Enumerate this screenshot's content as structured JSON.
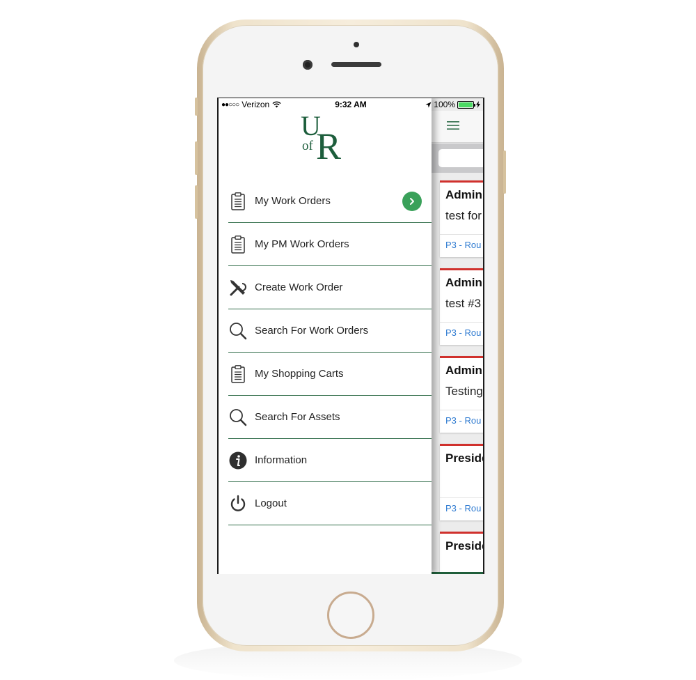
{
  "status_bar": {
    "carrier": "Verizon",
    "signal_dots": "●●○○○",
    "time": "9:32 AM",
    "battery": "100%"
  },
  "logo": {
    "u": "U",
    "of": "of",
    "r": "R"
  },
  "menu": {
    "items": [
      {
        "label": "My Work Orders",
        "icon": "clipboard-icon"
      },
      {
        "label": "My PM Work Orders",
        "icon": "clipboard-icon"
      },
      {
        "label": "Create Work Order",
        "icon": "tools-icon"
      },
      {
        "label": "Search For Work Orders",
        "icon": "search-icon"
      },
      {
        "label": "My Shopping Carts",
        "icon": "clipboard-icon"
      },
      {
        "label": "Search For Assets",
        "icon": "search-icon"
      },
      {
        "label": "Information",
        "icon": "info-icon"
      },
      {
        "label": "Logout",
        "icon": "power-icon"
      }
    ]
  },
  "work_orders": [
    {
      "title": "Admini",
      "description": "test for",
      "priority": "P3 - Rou"
    },
    {
      "title": "Admini",
      "description": "test #3",
      "priority": "P3 - Rou"
    },
    {
      "title": "Admini",
      "description": "Testing",
      "priority": "P3 - Rou"
    },
    {
      "title": "Preside",
      "description": "",
      "priority": "P3 - Rou"
    },
    {
      "title": "Preside",
      "description": "",
      "priority": ""
    }
  ],
  "colors": {
    "brand_green": "#1d5e3c",
    "divider_green": "#2e6b47",
    "go_button": "#3aa15a",
    "card_accent": "#d0312d",
    "priority_link": "#2f7bd1"
  }
}
